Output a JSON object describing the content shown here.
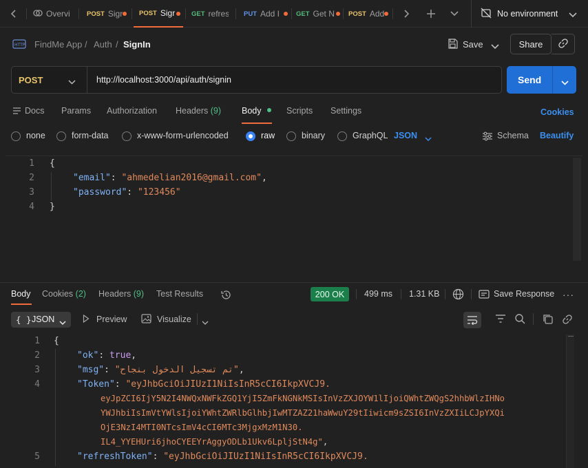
{
  "tabs": [
    {
      "method": "",
      "label": "Overvi",
      "dot": false,
      "active": false,
      "icon": "overview-icon"
    },
    {
      "method": "POST",
      "label": "Sigr",
      "dot": true,
      "active": false
    },
    {
      "method": "POST",
      "label": "Sigr",
      "dot": true,
      "active": true
    },
    {
      "method": "GET",
      "label": "refres",
      "dot": false,
      "active": false
    },
    {
      "method": "PUT",
      "label": "Add I",
      "dot": true,
      "active": false
    },
    {
      "method": "GET",
      "label": "Get N",
      "dot": true,
      "active": false
    },
    {
      "method": "POST",
      "label": "Add",
      "dot": true,
      "active": false
    }
  ],
  "environment": {
    "label": "No environment"
  },
  "breadcrumb": {
    "collection": "FindMe App",
    "folder": "Auth",
    "request": "SignIn",
    "separator": "/"
  },
  "toolbar": {
    "save_label": "Save",
    "share_label": "Share"
  },
  "request": {
    "method": "POST",
    "url": "http://localhost:3000/api/auth/signin",
    "send_label": "Send"
  },
  "request_tabs": {
    "docs": "Docs",
    "params": "Params",
    "authorization": "Authorization",
    "headers": "Headers",
    "headers_count": "(9)",
    "body": "Body",
    "scripts": "Scripts",
    "settings": "Settings",
    "cookies": "Cookies"
  },
  "body_types": {
    "none": "none",
    "form_data": "form-data",
    "urlencoded": "x-www-form-urlencoded",
    "raw": "raw",
    "binary": "binary",
    "graphql": "GraphQL",
    "format": "JSON",
    "schema": "Schema",
    "beautify": "Beautify",
    "selected": "raw"
  },
  "request_body": {
    "lines": [
      "1",
      "2",
      "3",
      "4"
    ],
    "open": "{",
    "email_key": "\"email\"",
    "email_value": "\"ahmedelian2016@gmail.com\"",
    "password_key": "\"password\"",
    "password_value": "\"123456\"",
    "close": "}"
  },
  "response_tabs": {
    "body": "Body",
    "cookies": "Cookies",
    "cookies_count": "(2)",
    "headers": "Headers",
    "headers_count": "(9)",
    "test_results": "Test Results"
  },
  "response_meta": {
    "status": "200 OK",
    "time": "499 ms",
    "size": "1.31 KB",
    "save_response": "Save Response"
  },
  "response_view": {
    "format": "JSON",
    "preview": "Preview",
    "visualize": "Visualize"
  },
  "response_body": {
    "lines": [
      "1",
      "2",
      "3",
      "4",
      "5"
    ],
    "open": "{",
    "ok_key": "\"ok\"",
    "ok_value": "true",
    "msg_key": "\"msg\"",
    "msg_value": "\"تم تسجيل الدخول بنجاح\"",
    "token_key": "\"Token\"",
    "token_lines": [
      "\"eyJhbGciOiJIUzI1NiIsInR5cCI6IkpXVCJ9.",
      "eyJpZCI6IjY5N2I4NWQxNWFkZGQ1YjI5ZmFkNGNkMSIsInVzZXJOYW1lIjoiQWhtZWQgS2hhbWlzIHNo",
      "YWJhbiIsImVtYWlsIjoiYWhtZWRlbGlhbjIwMTZAZ21haWwuY29tIiwicm9sZSI6InVzZXIiLCJpYXQi",
      "OjE3NzI4MTI0NTcsImV4cCI6MTc3MjgxMzM1N30.",
      "IL4_YYEHUri6jhoCYEEYrAggyODLb1Ukv6LpljStN4g\""
    ],
    "refresh_key": "\"refreshToken\"",
    "refresh_value": "\"eyJhbGciOiJIUzI1NiIsInR5cCI6IkpXVCJ9."
  },
  "colors": {
    "accent": "#f26b3a",
    "send": "#1f6fd6",
    "link": "#3b82f6",
    "status_ok": "#1a7f4b"
  }
}
